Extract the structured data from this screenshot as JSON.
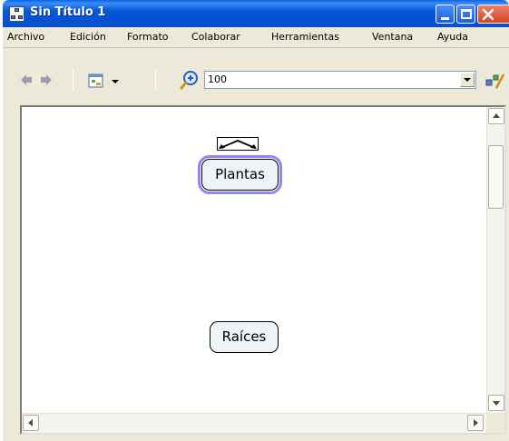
{
  "window": {
    "title": "Sin Título 1"
  },
  "menu": {
    "items": [
      "Archivo",
      "Edición",
      "Formato",
      "Colaborar",
      "Herramientas",
      "Ventana",
      "Ayuda"
    ]
  },
  "toolbar": {
    "icons": [
      "back-arrow-icon",
      "forward-arrow-icon",
      "view-menu-icon",
      "zoom-icon",
      "extra-tools-icon"
    ],
    "zoom_value": "100"
  },
  "concept_map": {
    "concepts": [
      {
        "label": "Plantas",
        "selected": true
      },
      {
        "label": "Raíces",
        "selected": false
      }
    ],
    "selection_color": "#8e88f5",
    "concept_fill": "#eef3f6"
  },
  "colors": {
    "titlebar": "#0756d6",
    "chrome": "#ece9d8",
    "close_button": "#d64420"
  }
}
